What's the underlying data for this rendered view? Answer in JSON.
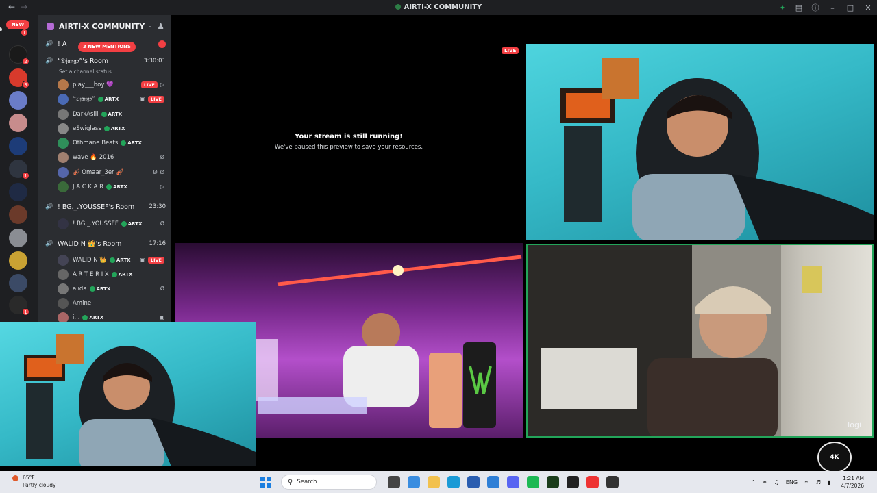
{
  "window": {
    "title": "AIRTI-X COMMUNITY"
  },
  "rail": {
    "new_label": "NEW",
    "badges": [
      "1",
      "2",
      "3",
      "1",
      "1"
    ]
  },
  "server": {
    "name": "AIRTI-X COMMUNITY",
    "mentions_label": "3 NEW MENTIONS",
    "partial_channel": "! A",
    "partial_channel_count": "1"
  },
  "rooms": [
    {
      "name": "“𝔇𝔧𝔞𝔫𝔤𝔬”'s Room",
      "time": "3:30:01",
      "status": "Set a channel status",
      "users": [
        {
          "name": "play___boy",
          "extra": "💜",
          "tag": "",
          "live": "LIVE"
        },
        {
          "name": "“𝔇𝔧𝔞𝔫𝔤𝔬”",
          "extra": "",
          "tag": "ARTX",
          "live": "LIVE"
        },
        {
          "name": "DarkAslli",
          "extra": "",
          "tag": "ARTX",
          "live": ""
        },
        {
          "name": "eSwiglass",
          "extra": "",
          "tag": "ARTX",
          "live": ""
        },
        {
          "name": "Othmane Beats",
          "extra": "",
          "tag": "ARTX",
          "live": ""
        },
        {
          "name": "wave",
          "extra": "🔥 2016",
          "tag": "",
          "live": ""
        },
        {
          "name": "🎻 Omaar_3er 🎻",
          "extra": "",
          "tag": "",
          "live": ""
        },
        {
          "name": "J A C K A R",
          "extra": "",
          "tag": "ARTX",
          "live": ""
        }
      ]
    },
    {
      "name": "! BG._.YOUSSEF's Room",
      "time": "23:30",
      "users": [
        {
          "name": "! BG._.YOUSSEF",
          "tag": "ARTX"
        }
      ]
    },
    {
      "name": "WALID N 👑's Room",
      "time": "17:16",
      "users": [
        {
          "name": "WALID N 👑",
          "tag": "ARTX",
          "live": "LIVE"
        },
        {
          "name": "A R T E R I X",
          "tag": "ARTX",
          "live": ""
        },
        {
          "name": "alida",
          "tag": "ARTX",
          "live": ""
        },
        {
          "name": "Amine",
          "tag": "",
          "live": ""
        },
        {
          "name": "i...",
          "tag": "ARTX",
          "live": ""
        }
      ]
    }
  ],
  "stage": {
    "paused_title": "Your stream is still running!",
    "paused_sub": "We've paused this preview to save your resources.",
    "live_label": "LIVE",
    "camera_brand": "logi",
    "watermark": "4K"
  },
  "taskbar": {
    "temperature": "65°F",
    "weather": "Partly cloudy",
    "search_placeholder": "Search",
    "language": "ENG",
    "time": "1:21 AM",
    "date": "4/7/2026"
  },
  "colors": {
    "accent_live": "#f23f43",
    "online": "#23a55a",
    "sidebar_bg": "#2b2d31",
    "rail_bg": "#1e1f22"
  }
}
